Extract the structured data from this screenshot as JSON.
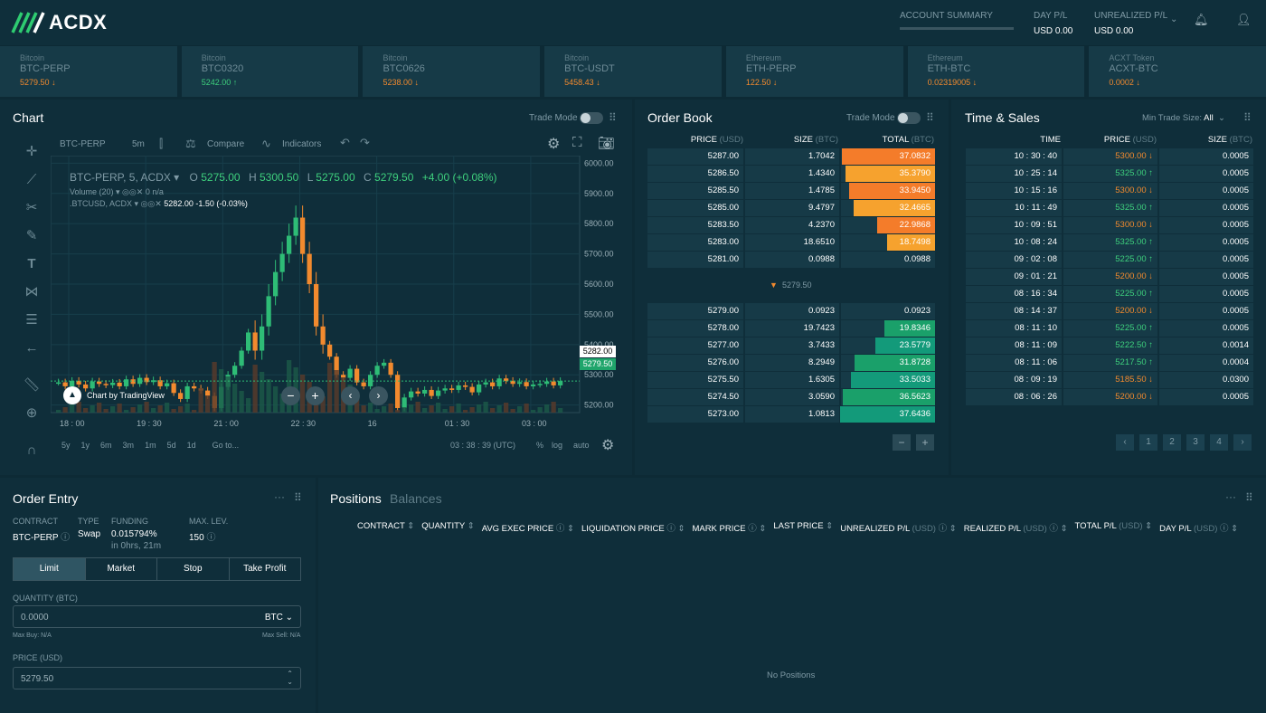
{
  "brand": {
    "name": "ACDX"
  },
  "header": {
    "account_summary": "ACCOUNT SUMMARY",
    "day_pl_label": "DAY P/L",
    "day_pl_value": "USD 0.00",
    "unrealized_label": "UNREALIZED P/L",
    "unrealized_value": "USD 0.00"
  },
  "tickers": [
    {
      "asset": "Bitcoin",
      "name": "BTC-PERP",
      "price": "5279.50",
      "dir": "down"
    },
    {
      "asset": "Bitcoin",
      "name": "BTC0320",
      "price": "5242.00",
      "dir": "up"
    },
    {
      "asset": "Bitcoin",
      "name": "BTC0626",
      "price": "5238.00",
      "dir": "down"
    },
    {
      "asset": "Bitcoin",
      "name": "BTC-USDT",
      "price": "5458.43",
      "dir": "down"
    },
    {
      "asset": "Ethereum",
      "name": "ETH-PERP",
      "price": "122.50",
      "dir": "down"
    },
    {
      "asset": "Ethereum",
      "name": "ETH-BTC",
      "price": "0.02319005",
      "dir": "down"
    },
    {
      "asset": "ACXT Token",
      "name": "ACXT-BTC",
      "price": "0.0002",
      "dir": "down"
    }
  ],
  "chart": {
    "title": "Chart",
    "trade_mode": "Trade Mode",
    "symbol": "BTC-PERP",
    "interval": "5m",
    "compare": "Compare",
    "indicators": "Indicators",
    "legend_symbol": "BTC-PERP, 5, ACDX",
    "o_label": "O",
    "o": "5275.00",
    "h_label": "H",
    "h": "5300.50",
    "l_label": "L",
    "l": "5275.00",
    "c_label": "C",
    "c": "5279.50",
    "change": "+4.00 (+0.08%)",
    "volume_label": "Volume (20)",
    "volume_value": "0 n/a",
    "btcusd_label": ".BTCUSD, ACDX",
    "btcusd_value": "5282.00",
    "btcusd_change": "-1.50 (-0.03%)",
    "price_tag_1": "5282.00",
    "price_tag_2": "5279.50",
    "attribution": "Chart by TradingView",
    "time_buttons": [
      "5y",
      "1y",
      "6m",
      "3m",
      "1m",
      "5d",
      "1d",
      "Go to..."
    ],
    "clock": "03 : 38 : 39 (UTC)",
    "pct": "%",
    "log": "log",
    "auto": "auto"
  },
  "chart_data": {
    "type": "candlestick",
    "y_ticks": [
      "6000.00",
      "5900.00",
      "5800.00",
      "5700.00",
      "5600.00",
      "5500.00",
      "5400.00",
      "5300.00",
      "5200.00"
    ],
    "ylim": [
      5175,
      6025
    ],
    "x_ticks": [
      "18 : 00",
      "19 : 30",
      "21 : 00",
      "22 : 30",
      "16",
      "01 : 30",
      "03 : 00"
    ],
    "close_path": [
      5275,
      5262,
      5280,
      5268,
      5255,
      5278,
      5270,
      5266,
      5274,
      5262,
      5285,
      5270,
      5290,
      5276,
      5282,
      5262,
      5272,
      5240,
      5220,
      5262,
      5255,
      5248,
      5230,
      5190,
      5260,
      5300,
      5330,
      5380,
      5440,
      5380,
      5460,
      5560,
      5640,
      5700,
      5760,
      5820,
      5700,
      5600,
      5460,
      5400,
      5360,
      5300,
      5290,
      5320,
      5275,
      5262,
      5300,
      5330,
      5340,
      5300,
      5190,
      5225,
      5245,
      5238,
      5250,
      5230,
      5248,
      5255,
      5250,
      5265,
      5260,
      5242,
      5268,
      5275,
      5262,
      5288,
      5280,
      5270,
      5276,
      5262,
      5268,
      5270,
      5278,
      5265,
      5279.5
    ]
  },
  "order_book": {
    "title": "Order Book",
    "trade_mode": "Trade Mode",
    "col_price": "PRICE",
    "col_price_unit": "(USD)",
    "col_size": "SIZE",
    "col_size_unit": "(BTC)",
    "col_total": "TOTAL",
    "col_total_unit": "(BTC)",
    "asks": [
      {
        "price": "5287.00",
        "size": "1.7042",
        "total": "37.0832",
        "depth": 0.98
      },
      {
        "price": "5286.50",
        "size": "1.4340",
        "total": "35.3790",
        "depth": 0.94
      },
      {
        "price": "5285.50",
        "size": "1.4785",
        "total": "33.9450",
        "depth": 0.9
      },
      {
        "price": "5285.00",
        "size": "9.4797",
        "total": "32.4665",
        "depth": 0.86
      },
      {
        "price": "5283.50",
        "size": "4.2370",
        "total": "22.9868",
        "depth": 0.61
      },
      {
        "price": "5283.00",
        "size": "18.6510",
        "total": "18.7498",
        "depth": 0.5
      },
      {
        "price": "5281.00",
        "size": "0.0988",
        "total": "0.0988",
        "depth": 0.0
      }
    ],
    "last": "5279.50",
    "bids": [
      {
        "price": "5279.00",
        "size": "0.0923",
        "total": "0.0923",
        "depth": 0.0
      },
      {
        "price": "5278.00",
        "size": "19.7423",
        "total": "19.8346",
        "depth": 0.53
      },
      {
        "price": "5277.00",
        "size": "3.7433",
        "total": "23.5779",
        "depth": 0.63
      },
      {
        "price": "5276.00",
        "size": "8.2949",
        "total": "31.8728",
        "depth": 0.85
      },
      {
        "price": "5275.50",
        "size": "1.6305",
        "total": "33.5033",
        "depth": 0.89
      },
      {
        "price": "5274.50",
        "size": "3.0590",
        "total": "36.5623",
        "depth": 0.97
      },
      {
        "price": "5273.00",
        "size": "1.0813",
        "total": "37.6436",
        "depth": 1.0
      }
    ],
    "minus": "−",
    "plus": "+"
  },
  "time_sales": {
    "title": "Time & Sales",
    "min_trade_label": "Min Trade Size:",
    "min_trade_value": "All",
    "col_time": "TIME",
    "col_price": "PRICE",
    "col_price_unit": "(USD)",
    "col_size": "SIZE",
    "col_size_unit": "(BTC)",
    "rows": [
      {
        "time": "10 : 30 : 40",
        "price": "5300.00",
        "dir": "down",
        "size": "0.0005"
      },
      {
        "time": "10 : 25 : 14",
        "price": "5325.00",
        "dir": "up",
        "size": "0.0005"
      },
      {
        "time": "10 : 15 : 16",
        "price": "5300.00",
        "dir": "down",
        "size": "0.0005"
      },
      {
        "time": "10 : 11 : 49",
        "price": "5325.00",
        "dir": "up",
        "size": "0.0005"
      },
      {
        "time": "10 : 09 : 51",
        "price": "5300.00",
        "dir": "down",
        "size": "0.0005"
      },
      {
        "time": "10 : 08 : 24",
        "price": "5325.00",
        "dir": "up",
        "size": "0.0005"
      },
      {
        "time": "09 : 02 : 08",
        "price": "5225.00",
        "dir": "up",
        "size": "0.0005"
      },
      {
        "time": "09 : 01 : 21",
        "price": "5200.00",
        "dir": "down",
        "size": "0.0005"
      },
      {
        "time": "08 : 16 : 34",
        "price": "5225.00",
        "dir": "up",
        "size": "0.0005"
      },
      {
        "time": "08 : 14 : 37",
        "price": "5200.00",
        "dir": "down",
        "size": "0.0005"
      },
      {
        "time": "08 : 11 : 10",
        "price": "5225.00",
        "dir": "up",
        "size": "0.0005"
      },
      {
        "time": "08 : 11 : 09",
        "price": "5222.50",
        "dir": "up",
        "size": "0.0014"
      },
      {
        "time": "08 : 11 : 06",
        "price": "5217.50",
        "dir": "up",
        "size": "0.0004"
      },
      {
        "time": "08 : 09 : 19",
        "price": "5185.50",
        "dir": "down",
        "size": "0.0300"
      },
      {
        "time": "08 : 06 : 26",
        "price": "5200.00",
        "dir": "down",
        "size": "0.0005"
      }
    ],
    "pages": [
      "‹",
      "1",
      "2",
      "3",
      "4",
      "›"
    ]
  },
  "order_entry": {
    "title": "Order Entry",
    "contract_label": "CONTRACT",
    "contract": "BTC-PERP",
    "type_label": "TYPE",
    "type": "Swap",
    "funding_label": "FUNDING",
    "funding": "0.015794%",
    "funding_time": "in 0hrs, 21m",
    "maxlev_label": "MAX. LEV.",
    "maxlev": "150",
    "tabs": [
      "Limit",
      "Market",
      "Stop",
      "Take Profit"
    ],
    "qty_label": "QUANTITY (BTC)",
    "qty_value": "0.0000",
    "qty_unit": "BTC",
    "max_buy": "Max Buy: N/A",
    "max_sell": "Max Sell: N/A",
    "price_label": "PRICE (USD)",
    "price_value": "5279.50"
  },
  "positions": {
    "tab_positions": "Positions",
    "tab_balances": "Balances",
    "columns": [
      "CONTRACT",
      "QUANTITY",
      "AVG EXEC PRICE",
      "LIQUIDATION PRICE",
      "MARK PRICE",
      "LAST PRICE",
      "UNREALIZED P/L",
      "REALIZED P/L",
      "TOTAL P/L",
      "DAY P/L"
    ],
    "usd": "(USD)",
    "empty": "No Positions"
  },
  "colors": {
    "bg": "#0d2a35",
    "panel": "#0f2e3a",
    "row": "#163a47",
    "green": "#3ed07d",
    "red": "#f28a2e",
    "ask_strong": "#f47c2a",
    "ask_light": "#f6a22e",
    "bid": "#1fa56b"
  }
}
